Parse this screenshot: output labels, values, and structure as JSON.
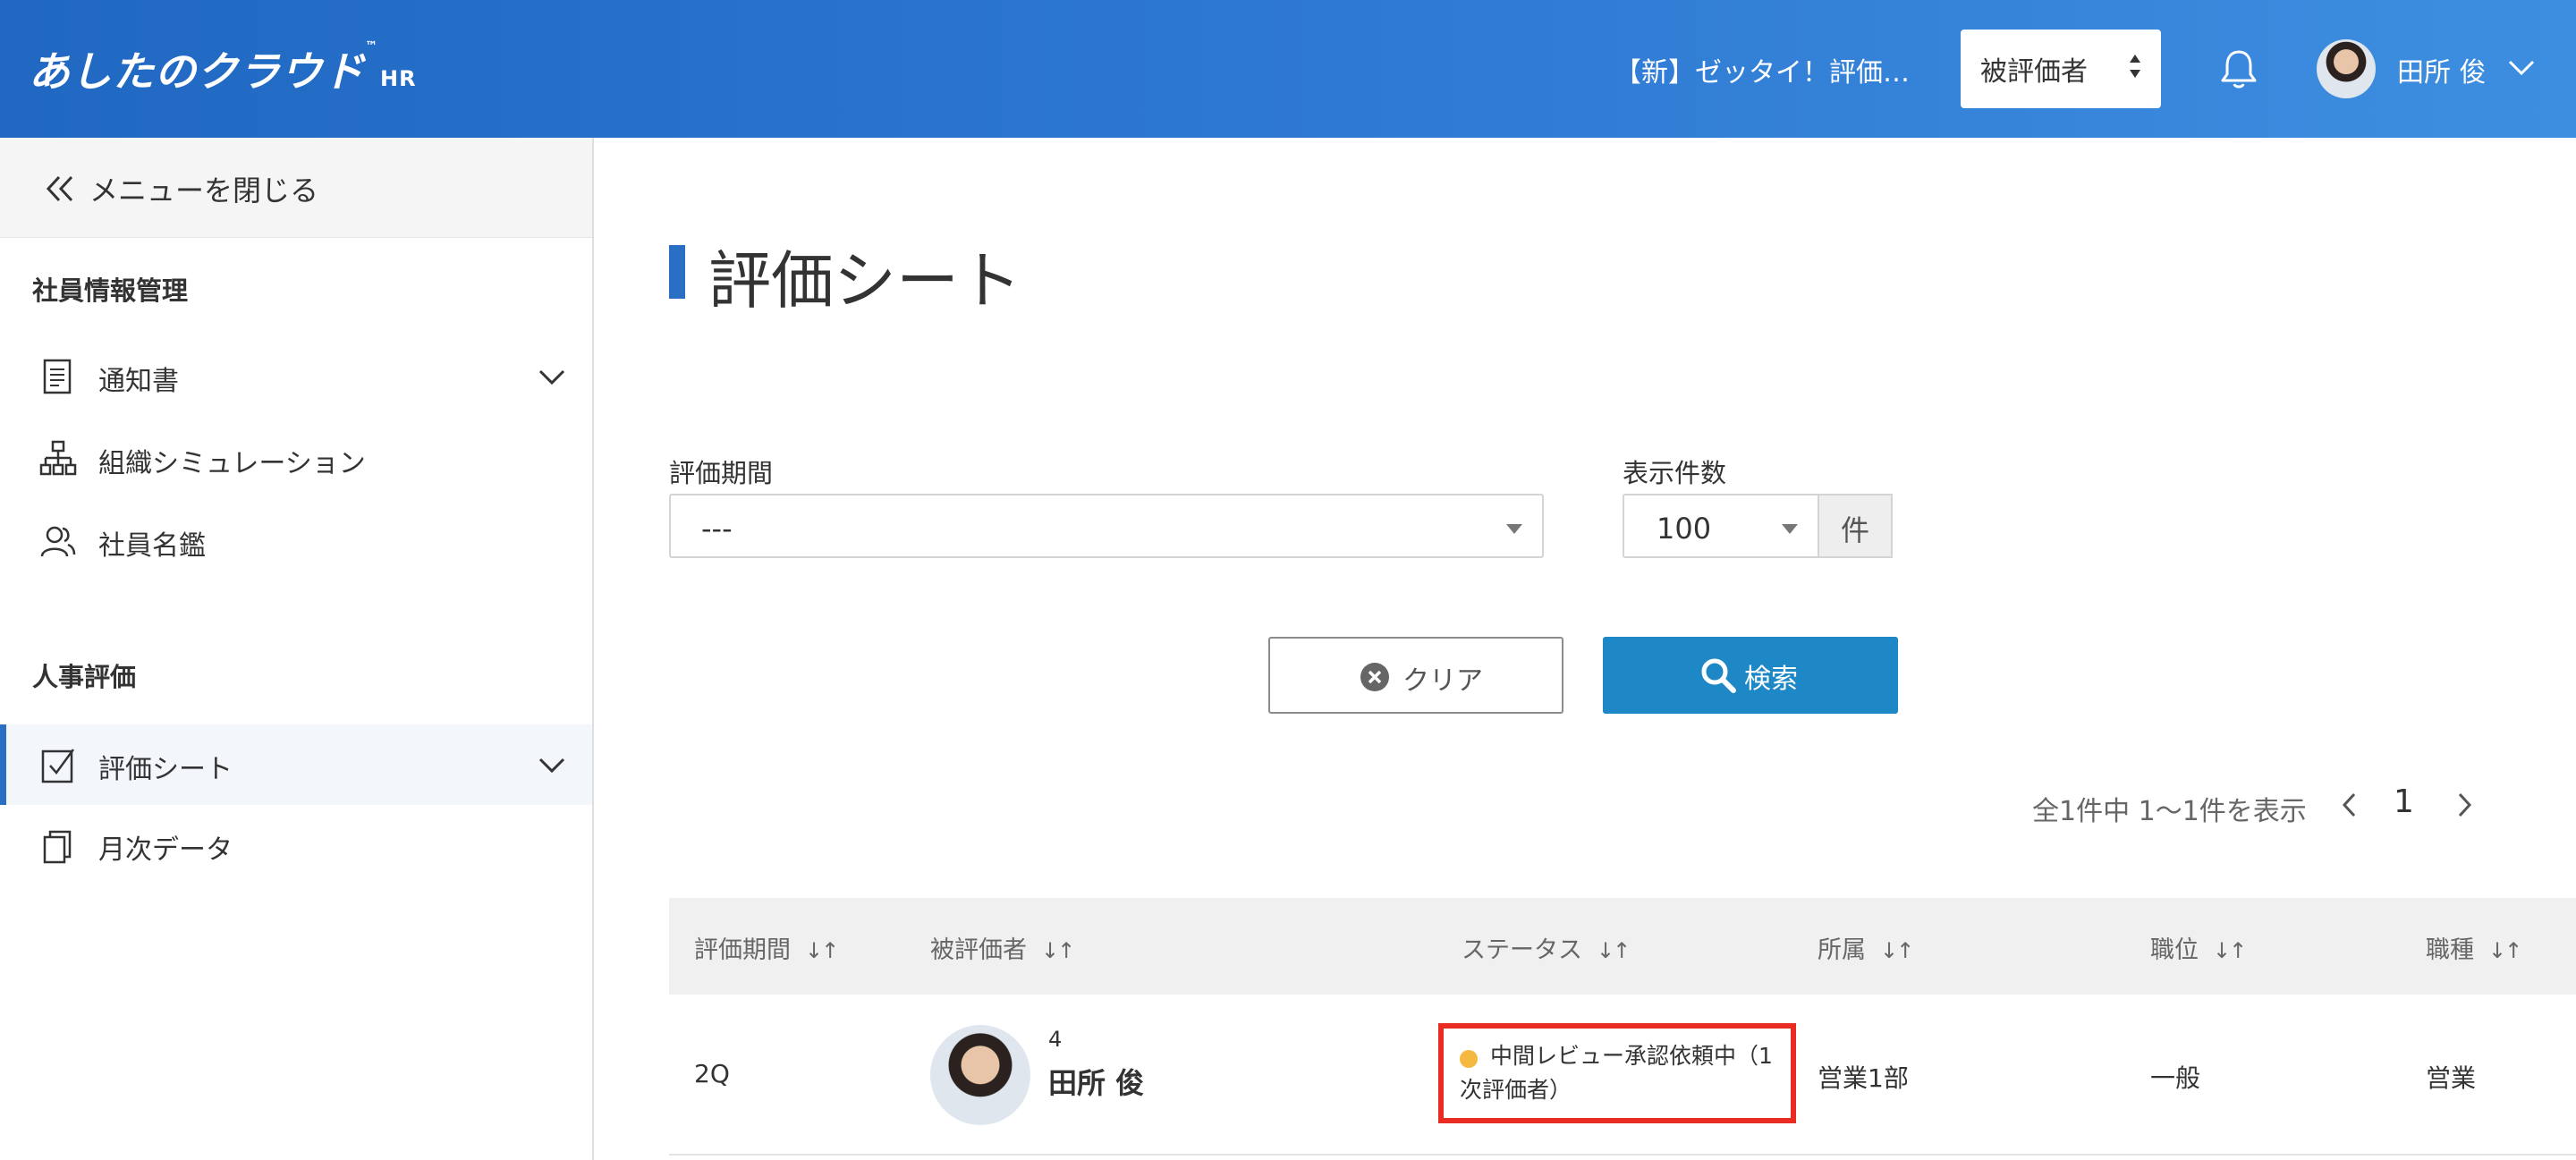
{
  "header": {
    "logo_text": "あしたのクラウド",
    "logo_tm": "™",
    "logo_suffix": "HR",
    "company": "【新】ゼッタイ！評価…",
    "role_select": "被評価者",
    "user_name": "田所 俊"
  },
  "sidebar": {
    "close_label": "メニューを閉じる",
    "sections": [
      {
        "title": "社員情報管理"
      },
      {
        "title": "人事評価"
      }
    ],
    "items": [
      {
        "label": "通知書",
        "icon": "document-icon",
        "has_chevron": true
      },
      {
        "label": "組織シミュレーション",
        "icon": "org-chart-icon"
      },
      {
        "label": "社員名鑑",
        "icon": "people-icon"
      },
      {
        "label": "評価シート",
        "icon": "checksheet-icon",
        "has_chevron": true,
        "active": true
      },
      {
        "label": "月次データ",
        "icon": "copy-icon"
      }
    ]
  },
  "main": {
    "title": "評価シート",
    "filters": {
      "period_label": "評価期間",
      "period_value": "---",
      "count_label": "表示件数",
      "count_value": "100",
      "count_unit": "件"
    },
    "buttons": {
      "clear": "クリア",
      "search": "検索"
    },
    "pagination": {
      "summary": "全1件中 1〜1件を表示",
      "current_page": "1"
    },
    "table": {
      "columns": [
        "評価期間",
        "被評価者",
        "ステータス",
        "所属",
        "職位",
        "職種"
      ],
      "sort_glyph": "↓↑",
      "rows": [
        {
          "period": "2Q",
          "employee_no": "4",
          "employee_name": "田所 俊",
          "status": "中間レビュー承認依頼中（1次評価者）",
          "department": "営業1部",
          "position": "一般",
          "job_type": "営業"
        }
      ]
    }
  },
  "colors": {
    "header_start": "#2068c2",
    "header_end": "#3d8ee1",
    "accent": "#2b6fc4",
    "search_button": "#1e88c6",
    "status_dot": "#f5b942",
    "highlight_border": "#e82c22"
  }
}
